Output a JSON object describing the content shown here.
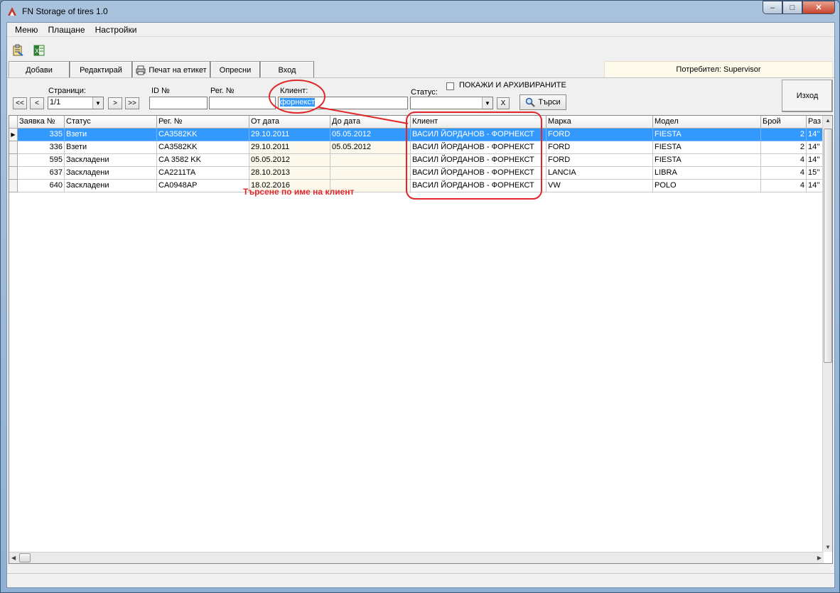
{
  "window": {
    "title": "FN Storage of tires 1.0",
    "controls": {
      "minimize": "–",
      "maximize": "□",
      "close": "✕"
    }
  },
  "menu": [
    "Меню",
    "Плащане",
    "Настройки"
  ],
  "toolbar": {
    "add": "Добави",
    "edit": "Редактирай",
    "print_label": "Печат на етикет",
    "refresh": "Опресни",
    "inbound": "Вход",
    "user": "Потребител: Supervisor"
  },
  "filters": {
    "pages_label": "Страници:",
    "pages_value": "1/1",
    "first": "<<",
    "prev": "<",
    "next": ">",
    "last": ">>",
    "id_label": "ID №",
    "id_value": "",
    "reg_label": "Рег. №",
    "reg_value": "",
    "client_label": "Клиент:",
    "client_value": "форнекст",
    "status_label": "Статус:",
    "status_value": "",
    "clear": "X",
    "show_archived": "ПОКАЖИ И АРХИВИРАНИТЕ",
    "show_archived_checked": false,
    "search": "Търси",
    "exit": "Изход"
  },
  "grid": {
    "columns": [
      "Заявка №",
      "Статус",
      "Рег. №",
      "От дата",
      "До дата",
      "Клиент",
      "Марка",
      "Модел",
      "Брой",
      "Раз"
    ],
    "rows": [
      [
        "335",
        "Взети",
        "CA3582KK",
        "29.10.2011",
        "05.05.2012",
        "ВАСИЛ ЙОРДАНОВ - ФОРНЕКСТ",
        "FORD",
        "FIESTA",
        "2",
        "14''"
      ],
      [
        "336",
        "Взети",
        "CA3582KK",
        "29.10.2011",
        "05.05.2012",
        "ВАСИЛ ЙОРДАНОВ - ФОРНЕКСТ",
        "FORD",
        "FIESTA",
        "2",
        "14''"
      ],
      [
        "595",
        "Заскладени",
        "CA 3582 KK",
        "05.05.2012",
        "",
        "ВАСИЛ ЙОРДАНОВ - ФОРНЕКСТ",
        "FORD",
        "FIESTA",
        "4",
        "14''"
      ],
      [
        "637",
        "Заскладени",
        "CA2211TA",
        "28.10.2013",
        "",
        "ВАСИЛ ЙОРДАНОВ - ФОРНЕКСТ",
        "LANCIA",
        "LIBRA",
        "4",
        "15''"
      ],
      [
        "640",
        "Заскладени",
        "CA0948AP",
        "18.02.2016",
        "",
        "ВАСИЛ ЙОРДАНОВ - ФОРНЕКСТ",
        "VW",
        "POLO",
        "4",
        "14''"
      ]
    ],
    "selected_row": 0
  },
  "annotation": {
    "text": "Търсене по име на клиент",
    "color": "#e0282a"
  }
}
